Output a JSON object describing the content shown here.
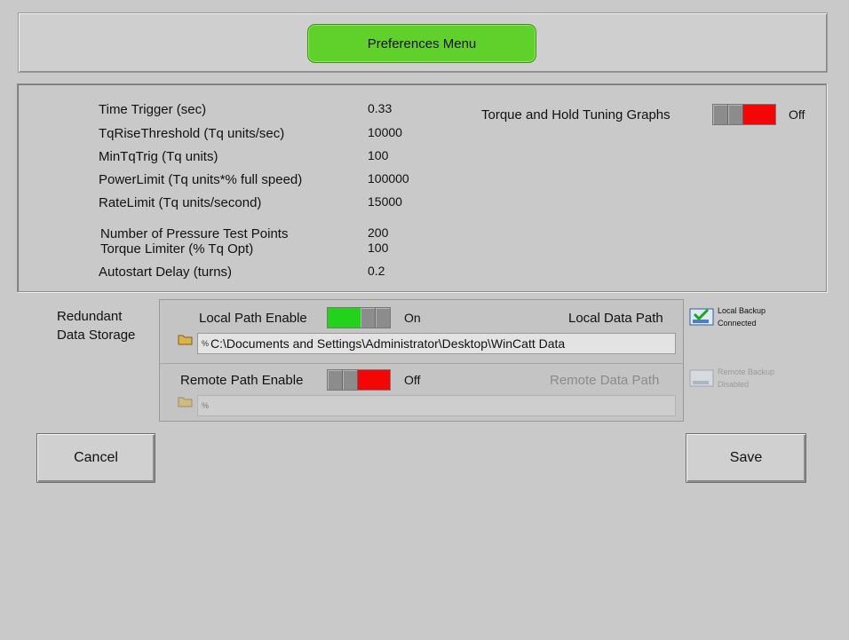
{
  "header": {
    "title": "Preferences Menu"
  },
  "settings": [
    {
      "label": "Time Trigger (sec)",
      "value": "0.33"
    },
    {
      "label": "TqRiseThreshold (Tq units/sec)",
      "value": "10000"
    },
    {
      "label": "MinTqTrig (Tq units)",
      "value": "100"
    },
    {
      "label": "PowerLimit (Tq units*% full speed)",
      "value": "100000"
    },
    {
      "label": "RateLimit (Tq units/second)",
      "value": "15000"
    },
    {
      "label": "Number of Pressure Test Points",
      "value": "200"
    },
    {
      "label": "Torque Limiter (% Tq Opt)",
      "value": "100"
    },
    {
      "label": "Autostart Delay (turns)",
      "value": "0.2"
    }
  ],
  "tuning": {
    "label": "Torque and Hold Tuning Graphs",
    "state": "Off"
  },
  "storage": {
    "label_line1": "Redundant",
    "label_line2": "Data Storage",
    "local": {
      "enable_label": "Local Path Enable",
      "state": "On",
      "path_label": "Local Data Path",
      "path_prefix": "%",
      "path": "C:\\Documents and Settings\\Administrator\\Desktop\\WinCatt Data",
      "status_line1": "Local Backup",
      "status_line2": "Connected"
    },
    "remote": {
      "enable_label": "Remote Path Enable",
      "state": "Off",
      "path_label": "Remote Data Path",
      "path_prefix": "%",
      "path": "",
      "status_line1": "Remote Backup",
      "status_line2": "Disabled"
    }
  },
  "buttons": {
    "cancel": "Cancel",
    "save": "Save"
  },
  "colors": {
    "accent_green": "#5fd12a",
    "on": "#22d31b",
    "off": "#f40606",
    "background": "#c9c9c9"
  }
}
